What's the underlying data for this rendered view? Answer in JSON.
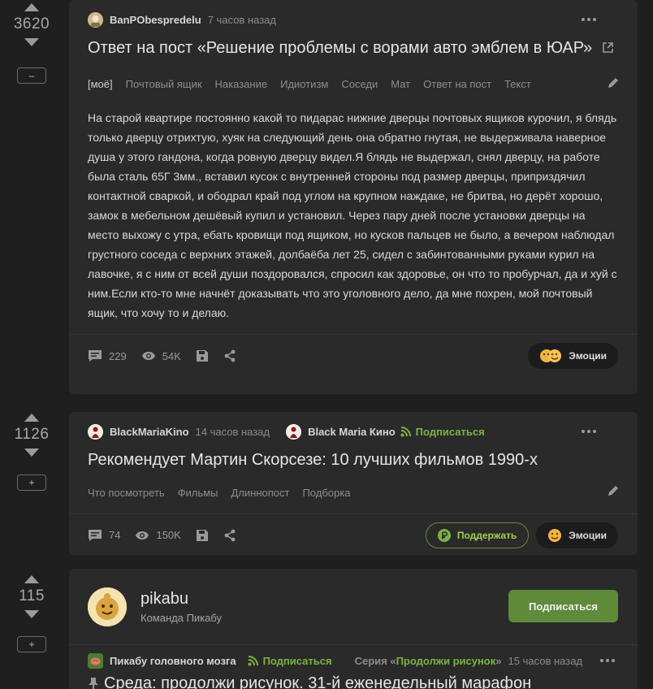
{
  "posts": [
    {
      "rating": "3620",
      "collapse_label": "–",
      "author": "BanPObespredelu",
      "time": "7 часов назад",
      "title": "Ответ на пост «Решение проблемы с ворами авто эмблем в ЮАР»",
      "tags": [
        "[моё]",
        "Почтовый ящик",
        "Наказание",
        "Идиотизм",
        "Соседи",
        "Мат",
        "Ответ на пост",
        "Текст"
      ],
      "text": "На старой квартире постоянно какой то пидарас нижние дверцы почтовых ящиков курочил, я блядь только дверцу отрихтую, хуяк на следующий день она обратно гнутая, не выдерживала наверное душа у этого гандона, когда ровную дверцу видел.Я блядь не выдержал, снял дверцу, на работе была сталь 65Г 3мм., вставил кусок с внутренней стороны под размер дверцы, приприздячил контактной сваркой, и ободрал край под углом на крупном наждаке, не бритва, но дерёт хорошо, замок в мебельном дешёвый купил и установил. Через пару дней после установки дверцы на место выхожу с утра, ебать кровищи под ящиком, но кусков пальцев не было, а вечером наблюдал грустного соседа с верхних этажей, долбаёба лет 25, сидел с забинтованными руками курил на лавочке, я с ним от всей души поздоровался, спросил как здоровье, он что то пробурчал, да и хуй с ним.Если кто-то мне начнёт доказывать что это уголовного дело, да мне похрен, мой почтовый ящик, что хочу то и делаю.",
      "comments": "229",
      "views": "54K",
      "emotions_label": "Эмоции"
    },
    {
      "rating": "1126",
      "collapse_label": "+",
      "author": "BlackMariaKino",
      "time": "14 часов назад",
      "community": "Black Maria Кино",
      "subscribe_label": "Подписаться",
      "title": "Рекомендует Мартин Скорсезе: 10 лучших фильмов 1990-х",
      "tags": [
        "Что посмотреть",
        "Фильмы",
        "Длиннопост",
        "Подборка"
      ],
      "comments": "74",
      "views": "150K",
      "support_label": "Поддержать",
      "emotions_label": "Эмоции"
    }
  ],
  "pikabu_block": {
    "rating": "115",
    "collapse_label": "+",
    "name": "pikabu",
    "subtitle": "Команда Пикабу",
    "subscribe_label": "Подписаться",
    "community": "Пикабу головного мозга",
    "community_subscribe": "Подписаться",
    "series_prefix": "Серия «",
    "series_name": "Продолжи рисунок",
    "series_suffix": "»",
    "time": "15 часов назад",
    "partial_title": "Среда: продолжи рисунок. 31-й еженедельный марафон"
  },
  "colors": {
    "background": "#1f1f1f",
    "card": "#2a2a2a",
    "accent_green": "#7cb342",
    "button_green": "#5e8a3a"
  }
}
